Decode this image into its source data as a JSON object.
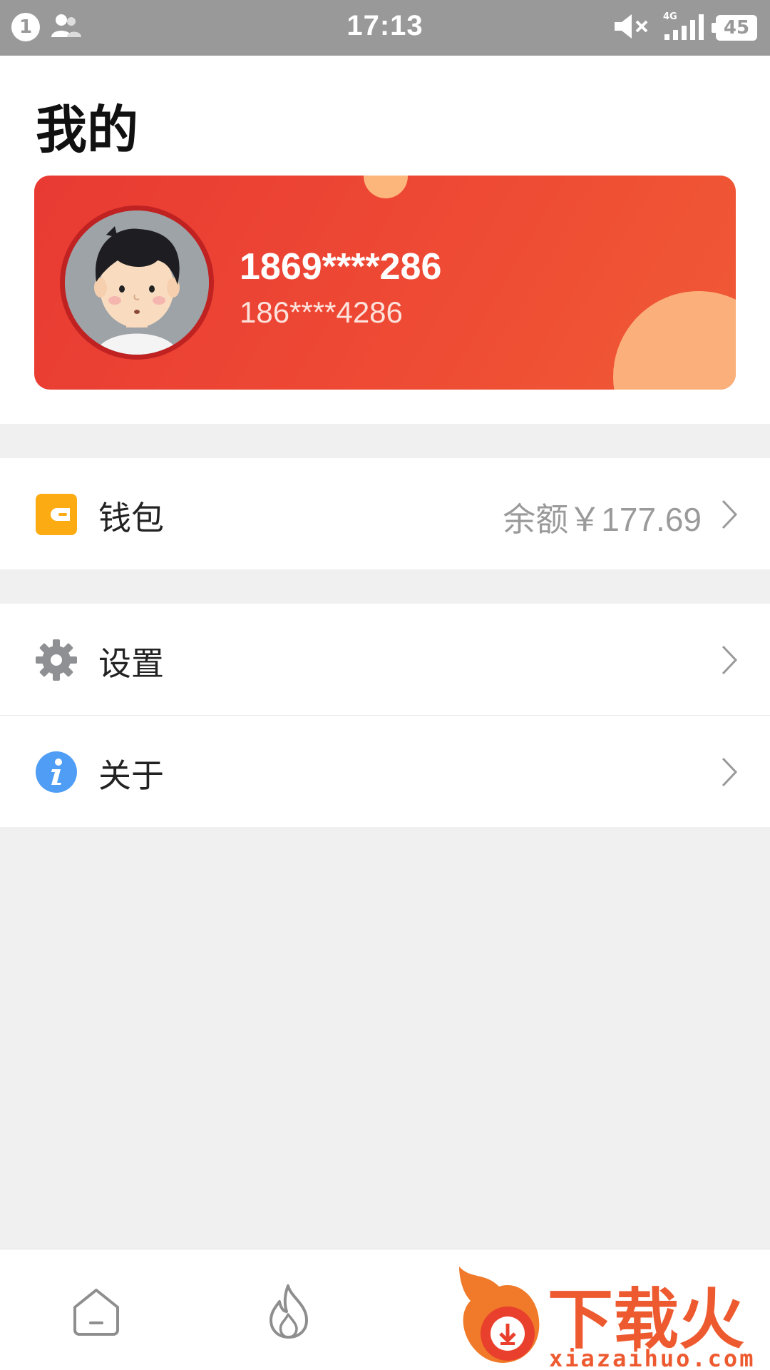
{
  "status_bar": {
    "notification_count": "1",
    "time": "17:13",
    "network": "4G",
    "battery": "45",
    "icons": [
      "contacts-icon",
      "mute-icon",
      "signal-icon",
      "battery-icon"
    ]
  },
  "header": {
    "title": "我的"
  },
  "profile": {
    "name": "1869****286",
    "phone": "186****4286",
    "colors": {
      "card": "#ee4233",
      "accent": "#fbb07b"
    }
  },
  "menu": {
    "wallet": {
      "label": "钱包",
      "value": "余额￥177.69",
      "icon": "wallet-icon"
    },
    "settings": {
      "label": "设置",
      "icon": "gear-icon"
    },
    "about": {
      "label": "关于",
      "icon": "info-icon"
    }
  },
  "bottom_nav": {
    "items": [
      {
        "icon": "home-icon"
      },
      {
        "icon": "fire-icon"
      }
    ]
  },
  "watermark": {
    "brand": "下载火",
    "url": "xiazaihuo.com"
  }
}
